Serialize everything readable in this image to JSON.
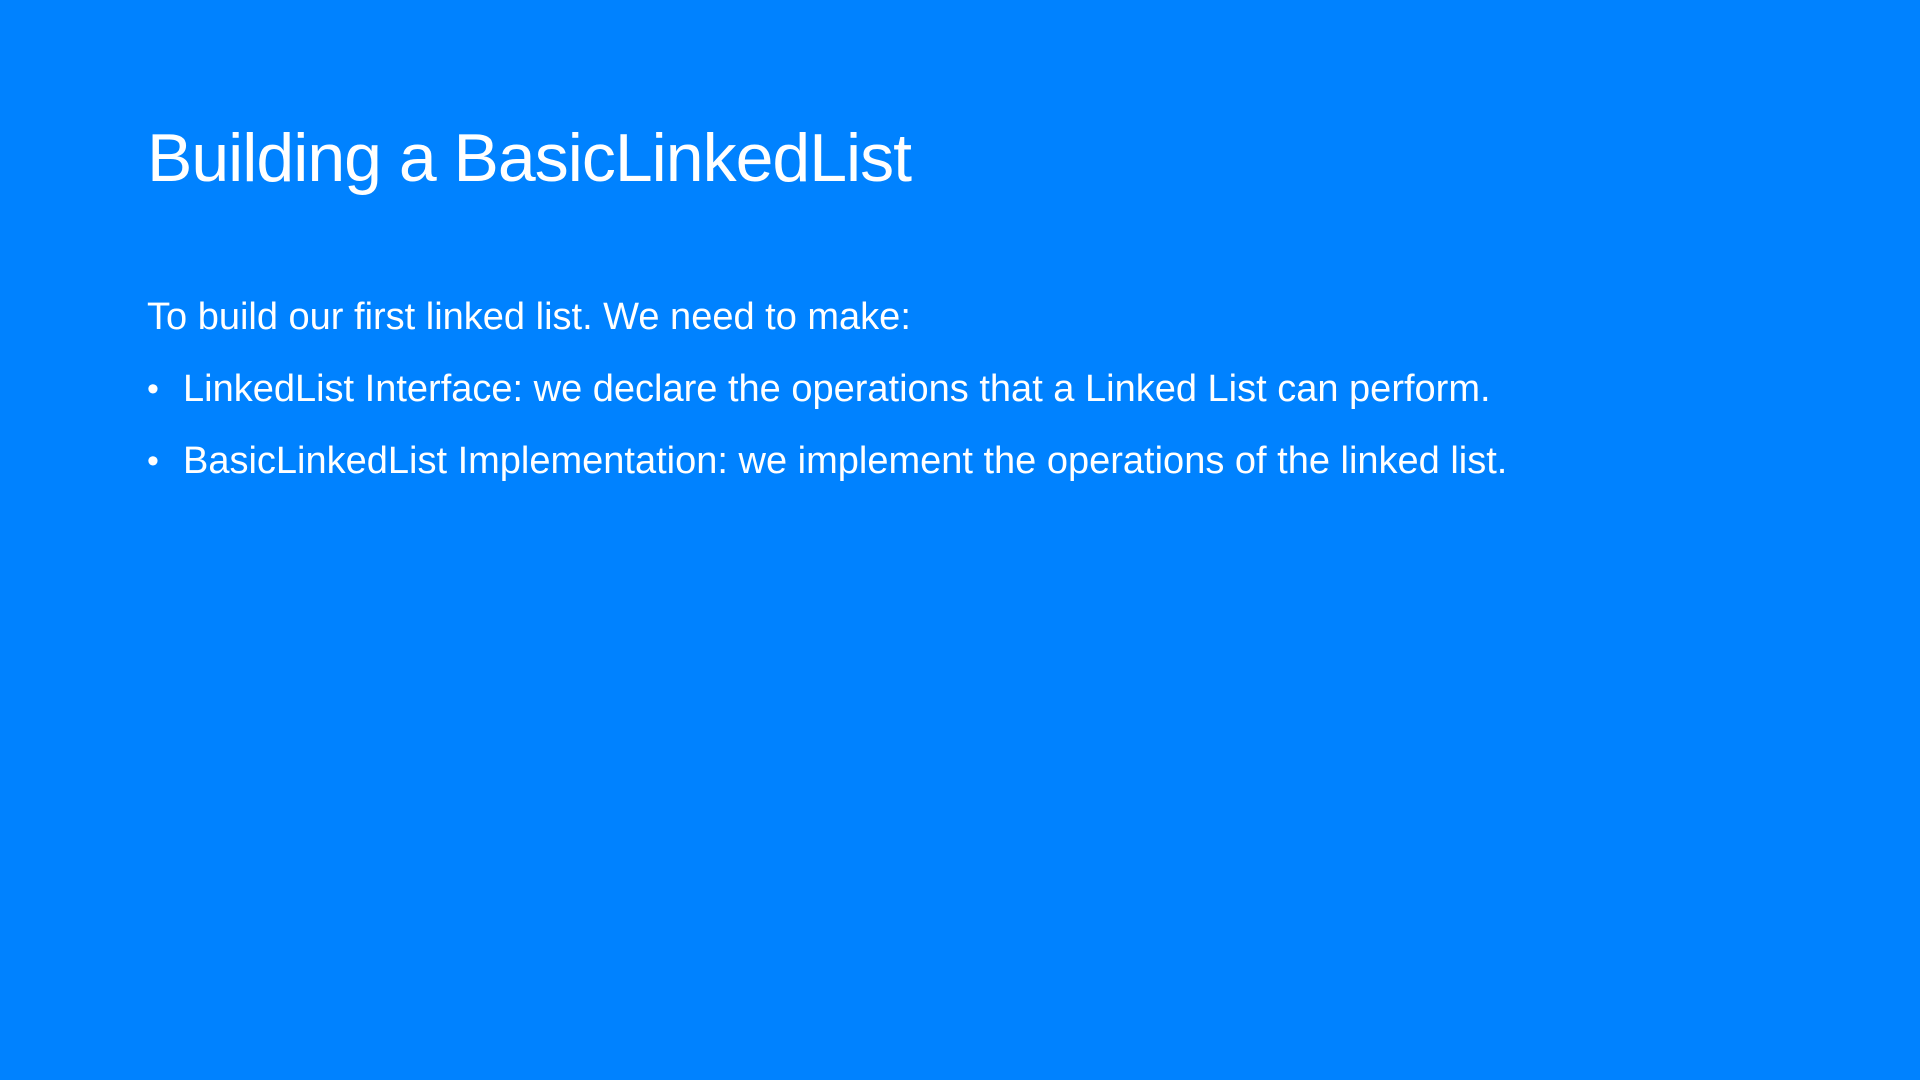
{
  "slide": {
    "background_color": "#0082FF",
    "text_color": "#FFFFFF",
    "title": "Building a BasicLinkedList",
    "intro": "To build our first linked list. We need to make:",
    "bullets": [
      {
        "marker": "•",
        "text": "LinkedList Interface: we declare the operations that a Linked List can perform."
      },
      {
        "marker": "•",
        "text": "BasicLinkedList Implementation: we implement the operations of the linked list."
      }
    ]
  }
}
